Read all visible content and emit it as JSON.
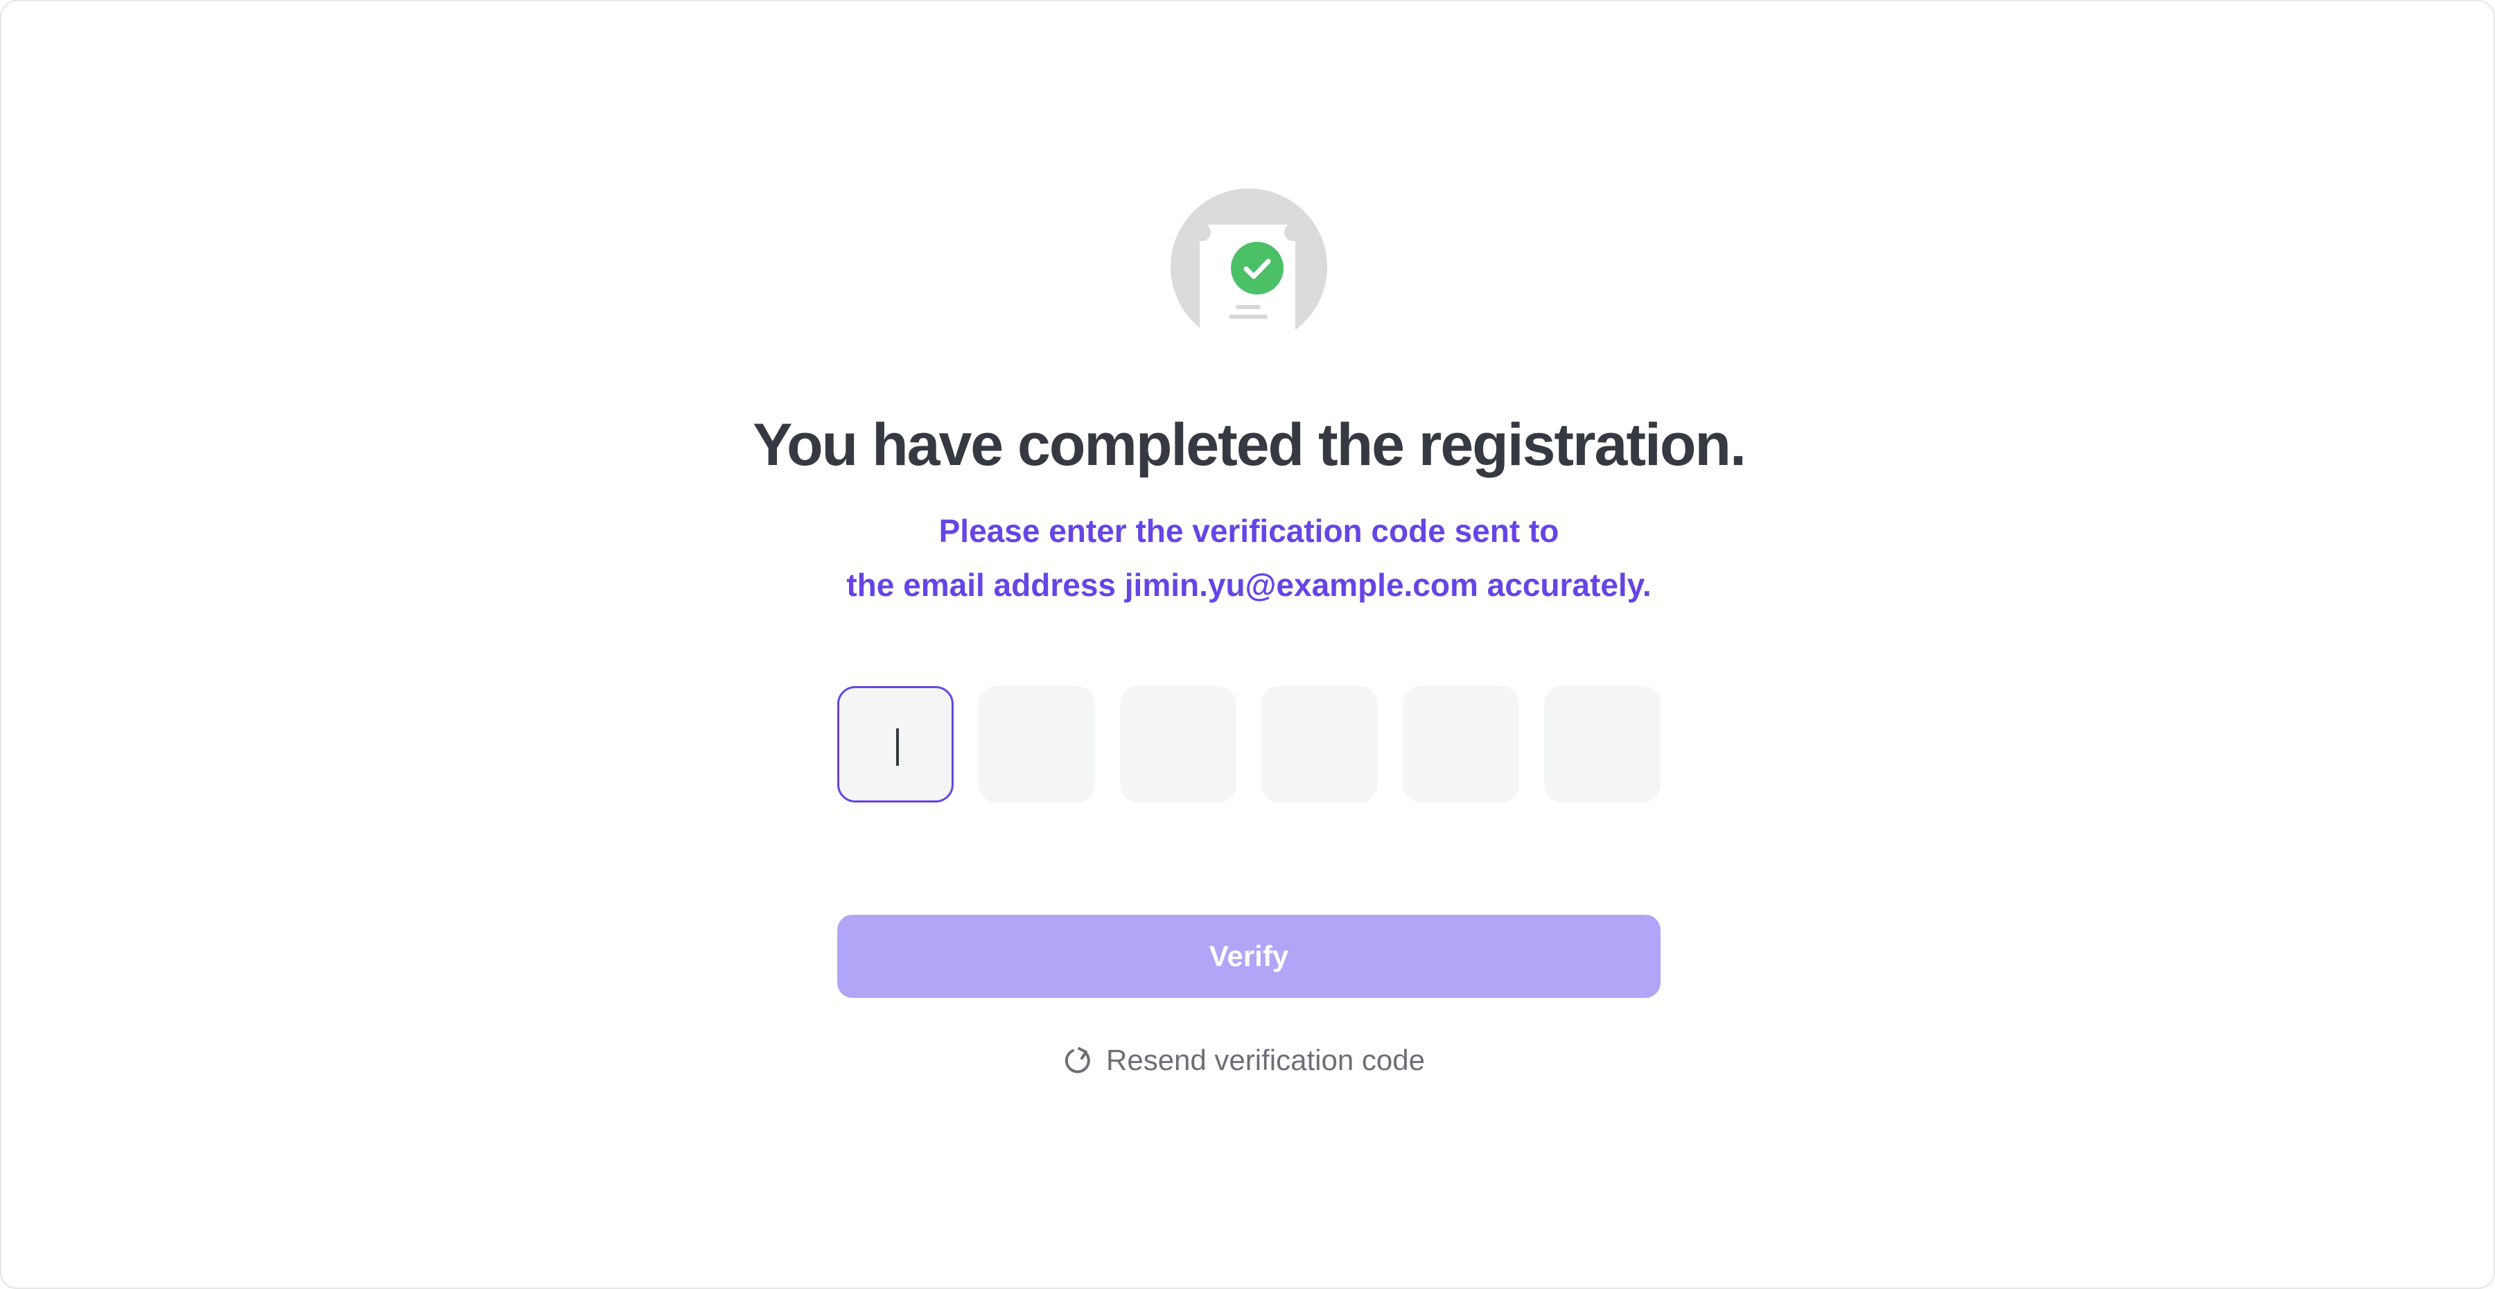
{
  "illustration": {
    "icon": "document-check-icon",
    "badge_color": "#4bc067",
    "circle_color": "#dadbdd"
  },
  "heading": "You have completed the registration.",
  "message": {
    "line1": "Please enter the verification code sent to",
    "line2": "the email address jimin.yu@example.com accurately.",
    "color": "#6644e6"
  },
  "code_inputs": {
    "count": 6,
    "values": [
      "",
      "",
      "",
      "",
      "",
      ""
    ],
    "active_index": 0
  },
  "verify_button": {
    "label": "Verify",
    "color": "#b1a5f8",
    "state": "disabled"
  },
  "resend": {
    "icon": "refresh-icon",
    "label": "Resend verification code"
  }
}
